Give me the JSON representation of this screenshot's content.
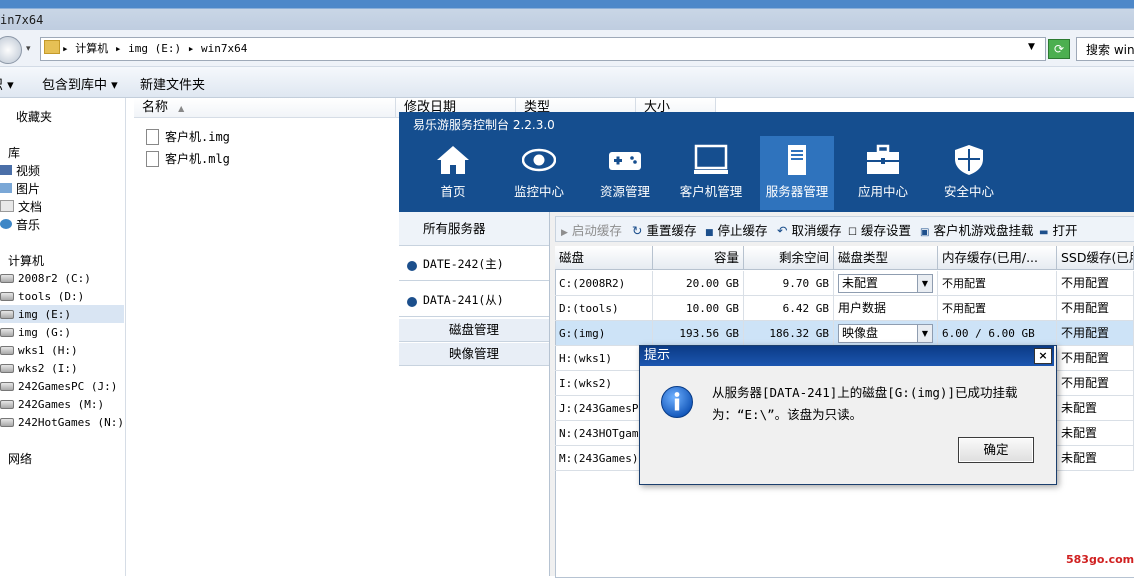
{
  "window": {
    "title": "in7x64"
  },
  "address_bar": {
    "path": "▸ 计算机 ▸ img (E:) ▸ win7x64",
    "search_placeholder": "搜索 win"
  },
  "toolbar": {
    "organize_fragment": "织 ▾",
    "include_in_library": "包含到库中 ▾",
    "new_folder": "新建文件夹"
  },
  "nav_pane": {
    "favorites": "收藏夹",
    "libraries": "库",
    "library_items": [
      "视频",
      "图片",
      "文档",
      "音乐"
    ],
    "computer": "计算机",
    "drives": [
      "2008r2 (C:)",
      "tools (D:)",
      "img (E:)",
      "img (G:)",
      "wks1 (H:)",
      "wks2 (I:)",
      "242GamesPC (J:)",
      "242Games (M:)",
      "242HotGames (N:)"
    ],
    "network": "网络"
  },
  "file_list": {
    "columns": [
      "名称",
      "修改日期",
      "类型",
      "大小"
    ],
    "files": [
      "客户机.img",
      "客户机.mlg"
    ]
  },
  "app": {
    "title": "易乐游服务控制台 2.2.3.0",
    "nav": [
      "首页",
      "监控中心",
      "资源管理",
      "客户机管理",
      "服务器管理",
      "应用中心",
      "安全中心"
    ],
    "active_nav": "服务器管理",
    "servers": {
      "all_label": "所有服务器",
      "items": [
        "DATE-242(主)",
        "DATA-241(从)"
      ],
      "sub_items": [
        "磁盘管理",
        "映像管理"
      ]
    },
    "disk_toolbar": [
      "启动缓存",
      "重置缓存",
      "停止缓存",
      "取消缓存",
      "缓存设置",
      "客户机游戏盘挂载",
      "打开"
    ],
    "grid": {
      "headers": [
        "磁盘",
        "容量",
        "剩余空间",
        "磁盘类型",
        "内存缓存(已用/...",
        "SSD缓存(已用"
      ],
      "rows": [
        {
          "disk": "C:(2008R2)",
          "capacity": "20.00 GB",
          "free": "9.70 GB",
          "type": "未配置",
          "type_combo": true,
          "mem": "不用配置",
          "ssd": "不用配置"
        },
        {
          "disk": "D:(tools)",
          "capacity": "10.00 GB",
          "free": "6.42 GB",
          "type": "用户数据",
          "type_combo": false,
          "mem": "不用配置",
          "ssd": "不用配置"
        },
        {
          "disk": "G:(img)",
          "capacity": "193.56 GB",
          "free": "186.32 GB",
          "type": "映像盘",
          "type_combo": true,
          "mem": "6.00 / 6.00 GB",
          "ssd": "不用配置"
        },
        {
          "disk": "H:(wks1)",
          "capacity": "",
          "free": "",
          "type": "",
          "type_combo": false,
          "mem": "",
          "ssd": "不用配置"
        },
        {
          "disk": "I:(wks2)",
          "capacity": "",
          "free": "",
          "type": "",
          "type_combo": false,
          "mem": "",
          "ssd": "不用配置"
        },
        {
          "disk": "J:(243GamesPC)",
          "capacity": "",
          "free": "",
          "type": "",
          "type_combo": false,
          "mem": "",
          "ssd": "未配置"
        },
        {
          "disk": "N:(243HOTgames",
          "capacity": "",
          "free": "",
          "type": "",
          "type_combo": false,
          "mem": "",
          "ssd": "未配置"
        },
        {
          "disk": "M:(243Games)",
          "capacity": "",
          "free": "",
          "type": "",
          "type_combo": false,
          "mem": "",
          "ssd": "未配置"
        }
      ]
    }
  },
  "dialog": {
    "title": "提示",
    "message": "从服务器[DATA-241]上的磁盘[G:(img)]已成功挂载为：“E:\\”。该盘为只读。",
    "ok": "确定",
    "close": "×"
  },
  "watermark": "583go.com"
}
